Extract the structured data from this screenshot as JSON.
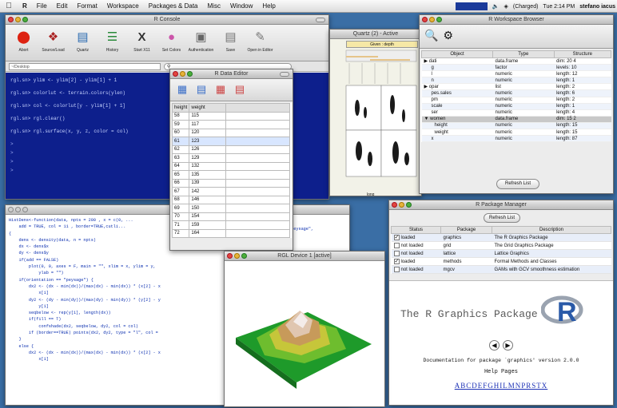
{
  "menubar": {
    "app": "R",
    "items": [
      "File",
      "Edit",
      "Format",
      "Workspace",
      "Packages & Data",
      "Misc",
      "Window",
      "Help"
    ],
    "battery": "(Charged)",
    "clock": "Tue 2:14 PM",
    "user": "stefano iacus"
  },
  "console": {
    "title": "R Console",
    "toolbar": [
      "Abort",
      "Source/Load",
      "Quartz",
      "History",
      "Start X11",
      "Set Colors",
      "Authentication",
      "Save",
      "Open in Editor"
    ],
    "path": "~/Desktop",
    "lines": [
      "rgl.sn> ylim <- ylim[2] - ylim[1] + 1",
      "rgl.sn> colorlut <- terrain.colors(ylen)",
      "rgl.sn> col <- colorlut[y - ylim[1] + 1]",
      "rgl.sn> rgl.clear()",
      "rgl.sn> rgl.surface(x, y, z, color = col)"
    ],
    "prompts": [
      ">",
      ">",
      ">",
      ">"
    ]
  },
  "quartz": {
    "title": "Quartz (2) - Active",
    "strip": "Given : depth",
    "xlabel": "long"
  },
  "data_editor": {
    "title": "R Data Editor",
    "columns": [
      "height",
      "weight"
    ],
    "rows": [
      [
        "58",
        "115"
      ],
      [
        "59",
        "117"
      ],
      [
        "60",
        "120"
      ],
      [
        "61",
        "123"
      ],
      [
        "62",
        "126"
      ],
      [
        "63",
        "129"
      ],
      [
        "64",
        "132"
      ],
      [
        "65",
        "135"
      ],
      [
        "66",
        "139"
      ],
      [
        "67",
        "142"
      ],
      [
        "68",
        "146"
      ],
      [
        "69",
        "150"
      ],
      [
        "70",
        "154"
      ],
      [
        "71",
        "159"
      ],
      [
        "72",
        "164"
      ]
    ]
  },
  "workspace": {
    "title": "R Workspace Browser",
    "columns": [
      "Object",
      "Type",
      "Structure"
    ],
    "rows": [
      [
        "▶ dati",
        "data.frame",
        "dim: 20 4"
      ],
      [
        "g",
        "factor",
        "levels: 10"
      ],
      [
        "l",
        "numeric",
        "length: 12"
      ],
      [
        "n",
        "numeric",
        "length: 1"
      ],
      [
        "▶ opar",
        "list",
        "length: 2"
      ],
      [
        "pes.sales",
        "numeric",
        "length: 6"
      ],
      [
        "pm",
        "numeric",
        "length: 2"
      ],
      [
        "scale",
        "numeric",
        "length: 1"
      ],
      [
        "ser",
        "numeric",
        "length: 4"
      ],
      [
        "▼ women",
        "data.frame",
        "dim: 15 2"
      ],
      [
        "height",
        "numeric",
        "length: 15"
      ],
      [
        "weight",
        "numeric",
        "length: 15"
      ],
      [
        "x",
        "numeric",
        "length: 87"
      ]
    ],
    "refresh": "Refresh List"
  },
  "editor": {
    "lines": [
      "HistDens<-function(data, npts = 200 , x = c(0, ...",
      "    add = TRUE, col = 11 , border=TRUE,cutli...",
      "{",
      "    dens <- density(data, n = npts)",
      "    dx <- dens$x",
      "    dy <- dens$y",
      "    if(add == FALSE)",
      "        plot(0, 0, axes = F, main = \"\", xlim = x, ylim = y,",
      "            ylab = \"\")",
      "    if(orientation == \"peysage\") {",
      "        dx2 <- (dx - min(dx))/(max(dx) - min(dx)) * (x[2] - x",
      "            x[1]",
      "        dy2 <- (dy - min(dy))/(max(dy) - min(dy)) * (y[2] - y",
      "            y[1]",
      "        seqbelow <- rep(y[1], length(dx))",
      "        if(fill == T)",
      "            confshade(dx2, seqbelow, dy2, col = col)",
      "        if (border==TRUE) points(dx2, dy2, type = \"l\", col =",
      "    }",
      "    else {",
      "        dx2 <- (dx - min(dx))/(max(dx) - min(dx)) * (x[2] - x",
      "            x[1]"
    ],
    "peysage": "\"peysage\","
  },
  "rdevice": {
    "title": "RGL Device 1 [active]"
  },
  "packages": {
    "title": "R Package Manager",
    "refresh": "Refresh List",
    "columns": [
      "Status",
      "Package",
      "Description"
    ],
    "rows": [
      [
        true,
        "loaded",
        "graphics",
        "The R Graphics Package"
      ],
      [
        false,
        "not loaded",
        "grid",
        "The Grid Graphics Package"
      ],
      [
        false,
        "not loaded",
        "lattice",
        "Lattice Graphics"
      ],
      [
        true,
        "loaded",
        "methods",
        "Formal Methods and Classes"
      ],
      [
        false,
        "not loaded",
        "mgcv",
        "GAMs with GCV smoothness estimation"
      ]
    ],
    "help_title": "The R Graphics Package",
    "help_doc": "Documentation for package `graphics' version 2.0.0",
    "help_pages": "Help Pages",
    "help_index": "ABCDEFGHILMNPRSTX"
  }
}
